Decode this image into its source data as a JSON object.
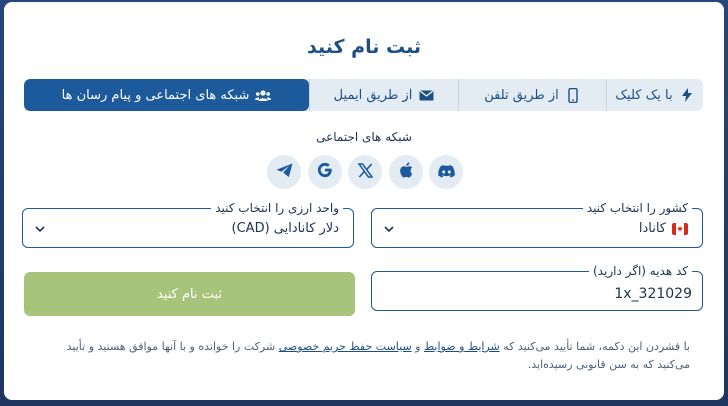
{
  "modal": {
    "title": "ثبت نام کنید"
  },
  "tabs": [
    {
      "label": "با یک کلیک",
      "icon": "lightning-icon",
      "active": false
    },
    {
      "label": "از طریق تلفن",
      "icon": "phone-icon",
      "active": false
    },
    {
      "label": "از طریق ایمیل",
      "icon": "envelope-icon",
      "active": false
    },
    {
      "label": "شبکه های اجتماعی و پیام رسان ها",
      "icon": "users-icon",
      "active": true
    }
  ],
  "social": {
    "label": "شبکه های اجتماعی",
    "networks": [
      "telegram-icon",
      "google-icon",
      "x-icon",
      "apple-icon",
      "discord-icon"
    ]
  },
  "country": {
    "label": "کشور را انتخاب کنید",
    "value": "کانادا"
  },
  "currency": {
    "label": "واحد ارزی را انتخاب کنید",
    "value": "دلار کانادایی (CAD)"
  },
  "promo": {
    "label": "کد هدیه (اگر دارید)",
    "value": "1x_321029"
  },
  "submit": {
    "label": "ثبت نام کنید"
  },
  "terms": {
    "prefix": "با فشردن این دکمه، شما تأیید می‌کنید که ",
    "link1": "شرایط و ضوابط",
    "mid": " و ",
    "link2": "سیاست حفظ حریم خصوصی",
    "suffix": " شرکت را خوانده و با آنها موافق هستید و تأیید می‌کنید که به سن قانونی رسیده‌اید."
  },
  "colors": {
    "primary": "#1d5a9b",
    "submit_disabled": "#a7c47a",
    "tab_bg": "#e3ebf3"
  }
}
